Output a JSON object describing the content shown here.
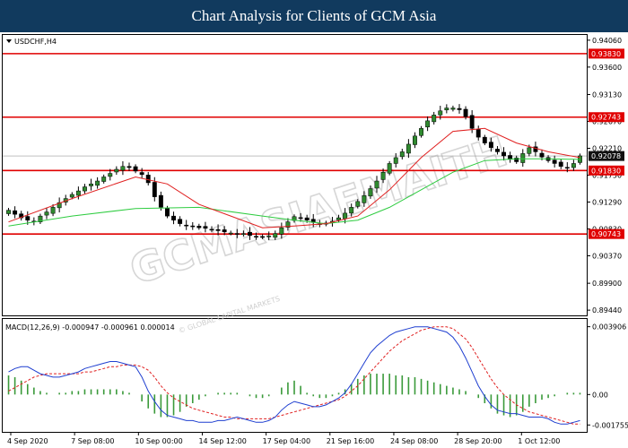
{
  "page_title": "Chart Analysis for Clients of GCM Asia",
  "chart_data": {
    "type": "candlestick",
    "symbol_label": "USDCHF,H4",
    "watermark_text": "GCMASIAEMAITH",
    "watermark_sub": "© GLOBAL CAPITAL MARKETS",
    "x_tick_labels": [
      "4 Sep 2020",
      "7 Sep 08:00",
      "10 Sep 00:00",
      "14 Sep 12:00",
      "17 Sep 04:00",
      "21 Sep 16:00",
      "24 Sep 08:00",
      "28 Sep 20:00",
      "1 Oct 12:00"
    ],
    "price_axis": {
      "ylim": [
        0.8935,
        0.9415
      ],
      "tick_labels": [
        "0.94060",
        "0.93600",
        "0.93130",
        "0.92670",
        "0.92210",
        "0.91750",
        "0.91290",
        "0.90830",
        "0.90370",
        "0.89900",
        "0.89440"
      ],
      "tick_values": [
        0.9406,
        0.936,
        0.9313,
        0.9267,
        0.9221,
        0.9175,
        0.9129,
        0.9083,
        0.9037,
        0.899,
        0.8944
      ]
    },
    "levels": [
      {
        "value": 0.9383,
        "label": "0.93830"
      },
      {
        "value": 0.92743,
        "label": "0.92743"
      },
      {
        "value": 0.9183,
        "label": "0.91830"
      },
      {
        "value": 0.90743,
        "label": "0.90743"
      }
    ],
    "current_price": {
      "value": 0.92078,
      "label": "0.92078"
    },
    "close_series": [
      0.9115,
      0.9108,
      0.9102,
      0.9098,
      0.9095,
      0.9105,
      0.9112,
      0.912,
      0.9128,
      0.9135,
      0.9142,
      0.9148,
      0.9155,
      0.916,
      0.9165,
      0.9172,
      0.9178,
      0.9185,
      0.919,
      0.9188,
      0.9182,
      0.9176,
      0.9162,
      0.9138,
      0.912,
      0.9105,
      0.9098,
      0.9092,
      0.9089,
      0.9087,
      0.9085,
      0.9084,
      0.9082,
      0.908,
      0.9078,
      0.9076,
      0.9074,
      0.9075,
      0.9072,
      0.907,
      0.9069,
      0.9071,
      0.9075,
      0.9085,
      0.9095,
      0.9104,
      0.9102,
      0.9098,
      0.9094,
      0.9092,
      0.9093,
      0.9096,
      0.9102,
      0.911,
      0.912,
      0.913,
      0.914,
      0.9152,
      0.9165,
      0.918,
      0.9195,
      0.9205,
      0.9215,
      0.9228,
      0.9242,
      0.9255,
      0.9268,
      0.9278,
      0.9285,
      0.929,
      0.929,
      0.9287,
      0.9275,
      0.9255,
      0.924,
      0.923,
      0.9222,
      0.9215,
      0.9208,
      0.9202,
      0.9198,
      0.9212,
      0.9222,
      0.9215,
      0.9206,
      0.92,
      0.9195,
      0.919,
      0.9188,
      0.9195,
      0.9208
    ],
    "ma_red": {
      "x": [
        0,
        10,
        20,
        25,
        30,
        40,
        45,
        50,
        55,
        60,
        65,
        70,
        75,
        80,
        85,
        90
      ],
      "y": [
        0.9095,
        0.9135,
        0.9172,
        0.916,
        0.9125,
        0.9085,
        0.9088,
        0.9092,
        0.9105,
        0.915,
        0.9205,
        0.925,
        0.9255,
        0.923,
        0.9215,
        0.9205
      ]
    },
    "ma_green": {
      "x": [
        0,
        10,
        20,
        30,
        40,
        45,
        50,
        55,
        60,
        65,
        70,
        75,
        80,
        85,
        90
      ],
      "y": [
        0.9088,
        0.9105,
        0.9118,
        0.912,
        0.9105,
        0.9098,
        0.9092,
        0.9098,
        0.912,
        0.915,
        0.918,
        0.92,
        0.9203,
        0.9203,
        0.9202
      ]
    },
    "macd": {
      "label": "MACD(12,26,9) -0.000947 -0.000961 0.000014",
      "ylim": [
        -0.0021,
        0.0043
      ],
      "tick_labels": [
        "0.003906",
        "0.00",
        "-0.001755"
      ],
      "tick_values": [
        0.003906,
        0.0,
        -0.001755
      ],
      "histogram": [
        0.0011,
        0.001,
        0.0008,
        0.0006,
        0.0004,
        0.0002,
        0.0001,
        0.0,
        0.0001,
        0.0001,
        0.0002,
        0.0002,
        0.0003,
        0.0003,
        0.0003,
        0.0003,
        0.0003,
        0.0003,
        0.0002,
        0.0001,
        0.0,
        -0.0004,
        -0.0008,
        -0.0011,
        -0.0013,
        -0.0013,
        -0.0012,
        -0.001,
        -0.0007,
        -0.0005,
        -0.0003,
        -0.0001,
        0.0,
        0.0001,
        0.0001,
        0.0001,
        0.0001,
        0.0,
        -0.0001,
        -0.0002,
        -0.0002,
        -0.0001,
        0.0,
        0.0004,
        0.0007,
        0.0008,
        0.0005,
        0.0001,
        -0.0001,
        -0.0002,
        -0.0002,
        -0.0001,
        0.0001,
        0.0003,
        0.0006,
        0.0009,
        0.0011,
        0.0012,
        0.0012,
        0.0012,
        0.0012,
        0.0011,
        0.0011,
        0.001,
        0.001,
        0.0009,
        0.0008,
        0.0007,
        0.0006,
        0.0005,
        0.0004,
        0.0003,
        0.0002,
        0.0,
        -0.0002,
        -0.0005,
        -0.0008,
        -0.0011,
        -0.0012,
        -0.0013,
        -0.0012,
        -0.001,
        -0.0007,
        -0.0005,
        -0.0003,
        -0.0002,
        -0.0001,
        0.0,
        0.0001,
        0.0001,
        0.0001
      ],
      "main": [
        0.0013,
        0.0015,
        0.0016,
        0.0016,
        0.0014,
        0.0012,
        0.0011,
        0.001,
        0.001,
        0.0011,
        0.0012,
        0.0013,
        0.0015,
        0.0016,
        0.0017,
        0.0018,
        0.0019,
        0.0019,
        0.0018,
        0.0017,
        0.0016,
        0.001,
        0.0002,
        -0.0004,
        -0.0009,
        -0.0012,
        -0.0013,
        -0.0014,
        -0.0015,
        -0.0015,
        -0.0016,
        -0.0016,
        -0.0016,
        -0.0015,
        -0.0015,
        -0.0014,
        -0.0013,
        -0.0014,
        -0.0015,
        -0.0016,
        -0.0016,
        -0.0015,
        -0.0013,
        -0.0009,
        -0.0006,
        -0.0004,
        -0.0005,
        -0.0006,
        -0.0007,
        -0.0007,
        -0.0006,
        -0.0004,
        -0.0002,
        0.0001,
        0.0006,
        0.0012,
        0.0018,
        0.0024,
        0.0028,
        0.0031,
        0.0034,
        0.0036,
        0.0037,
        0.0038,
        0.0039,
        0.0039,
        0.0039,
        0.0038,
        0.0037,
        0.0036,
        0.0033,
        0.0028,
        0.0021,
        0.0013,
        0.0005,
        -0.0001,
        -0.0006,
        -0.0009,
        -0.001,
        -0.0011,
        -0.0011,
        -0.0012,
        -0.0013,
        -0.0013,
        -0.0013,
        -0.0014,
        -0.0016,
        -0.0017,
        -0.0017,
        -0.0016,
        -0.0015
      ],
      "signal": [
        0.0002,
        0.0004,
        0.0006,
        0.0008,
        0.001,
        0.0011,
        0.0012,
        0.0012,
        0.0012,
        0.0012,
        0.0012,
        0.0012,
        0.0013,
        0.0013,
        0.0014,
        0.0015,
        0.0016,
        0.0016,
        0.0017,
        0.0017,
        0.0017,
        0.0016,
        0.0014,
        0.001,
        0.0005,
        0.0001,
        -0.0002,
        -0.0004,
        -0.0006,
        -0.0008,
        -0.0009,
        -0.001,
        -0.0011,
        -0.0012,
        -0.0013,
        -0.0013,
        -0.0014,
        -0.0014,
        -0.0014,
        -0.0014,
        -0.0014,
        -0.0014,
        -0.0013,
        -0.0012,
        -0.0011,
        -0.001,
        -0.0009,
        -0.0008,
        -0.0007,
        -0.0006,
        -0.0005,
        -0.0004,
        -0.0003,
        -0.0001,
        0.0002,
        0.0005,
        0.0009,
        0.0013,
        0.0017,
        0.0021,
        0.0025,
        0.0028,
        0.0031,
        0.0033,
        0.0035,
        0.0037,
        0.0038,
        0.0039,
        0.0039,
        0.0039,
        0.0038,
        0.0035,
        0.0032,
        0.0027,
        0.0021,
        0.0015,
        0.0009,
        0.0004,
        0.0,
        -0.0003,
        -0.0006,
        -0.0008,
        -0.001,
        -0.0011,
        -0.0012,
        -0.0013,
        -0.0014,
        -0.0015,
        -0.0016,
        -0.0017,
        -0.0017
      ]
    },
    "colors": {
      "bull_candle": "#2f8a2f",
      "bear_candle": "#000000",
      "level_line": "#e00000",
      "ma_red": "#e02020",
      "ma_green": "#2ecc40",
      "macd_main": "#1f3fd0",
      "macd_signal": "#e02020",
      "macd_histogram": "#3a9a3a",
      "current_price_box": "#111111"
    }
  }
}
